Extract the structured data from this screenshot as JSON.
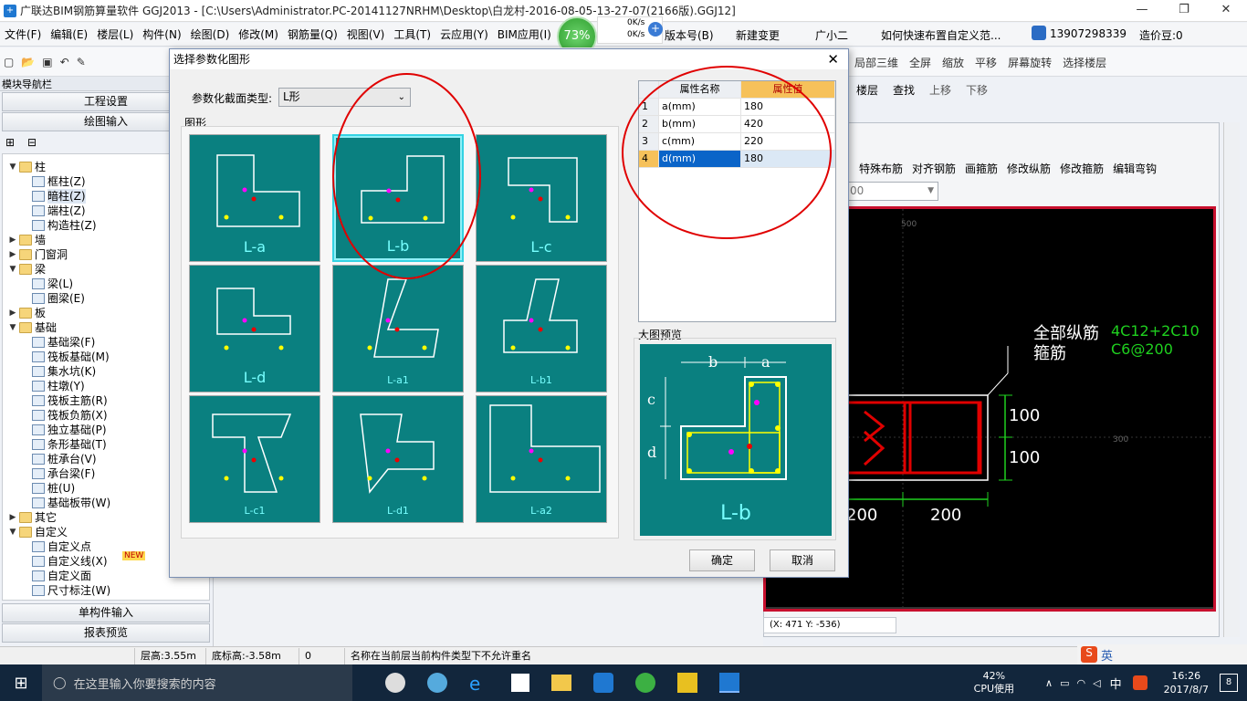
{
  "titlebar": {
    "text": "广联达BIM钢筋算量软件 GGJ2013 - [C:\\Users\\Administrator.PC-20141127NRHM\\Desktop\\白龙村-2016-08-05-13-27-07(2166版).GGJ12]"
  },
  "menu": [
    "文件(F)",
    "编辑(E)",
    "楼层(L)",
    "构件(N)",
    "绘图(D)",
    "修改(M)",
    "钢筋量(Q)",
    "视图(V)",
    "工具(T)",
    "云应用(Y)",
    "BIM应用(I)",
    "在",
    "版本号(B)",
    "新建变更",
    "广小二",
    "如何快速布置自定义范...",
    "13907298339",
    "造价豆:0"
  ],
  "netwidget": {
    "percent": "73%",
    "up": "0K/s",
    "down": "0K/s"
  },
  "toolbar_right": [
    "局部三维",
    "全屏",
    "缩放",
    "平移",
    "屏幕旋转",
    "选择楼层"
  ],
  "nav": {
    "title": "模块导航栏",
    "buttons": [
      "工程设置",
      "绘图输入"
    ],
    "bottom_buttons": [
      "单构件输入",
      "报表预览"
    ],
    "tree": [
      {
        "level": 0,
        "exp": "▼",
        "icon": "folder",
        "label": "柱"
      },
      {
        "level": 1,
        "icon": "comp",
        "label": "框柱(Z)"
      },
      {
        "level": 1,
        "icon": "comp",
        "label": "暗柱(Z)"
      },
      {
        "level": 1,
        "icon": "comp",
        "label": "端柱(Z)"
      },
      {
        "level": 1,
        "icon": "comp",
        "label": "构造柱(Z)"
      },
      {
        "level": 0,
        "exp": "▶",
        "icon": "folder",
        "label": "墙"
      },
      {
        "level": 0,
        "exp": "▶",
        "icon": "folder",
        "label": "门窗洞"
      },
      {
        "level": 0,
        "exp": "▼",
        "icon": "folder",
        "label": "梁"
      },
      {
        "level": 1,
        "icon": "comp",
        "label": "梁(L)"
      },
      {
        "level": 1,
        "icon": "comp",
        "label": "圈梁(E)"
      },
      {
        "level": 0,
        "exp": "▶",
        "icon": "folder",
        "label": "板"
      },
      {
        "level": 0,
        "exp": "▼",
        "icon": "folder",
        "label": "基础"
      },
      {
        "level": 1,
        "icon": "comp",
        "label": "基础梁(F)"
      },
      {
        "level": 1,
        "icon": "comp",
        "label": "筏板基础(M)"
      },
      {
        "level": 1,
        "icon": "comp",
        "label": "集水坑(K)"
      },
      {
        "level": 1,
        "icon": "comp",
        "label": "柱墩(Y)"
      },
      {
        "level": 1,
        "icon": "comp",
        "label": "筏板主筋(R)"
      },
      {
        "level": 1,
        "icon": "comp",
        "label": "筏板负筋(X)"
      },
      {
        "level": 1,
        "icon": "comp",
        "label": "独立基础(P)"
      },
      {
        "level": 1,
        "icon": "comp",
        "label": "条形基础(T)"
      },
      {
        "level": 1,
        "icon": "comp",
        "label": "桩承台(V)"
      },
      {
        "level": 1,
        "icon": "comp",
        "label": "承台梁(F)"
      },
      {
        "level": 1,
        "icon": "comp",
        "label": "桩(U)"
      },
      {
        "level": 1,
        "icon": "comp",
        "label": "基础板带(W)"
      },
      {
        "level": 0,
        "exp": "▶",
        "icon": "folder",
        "label": "其它"
      },
      {
        "level": 0,
        "exp": "▼",
        "icon": "folder",
        "label": "自定义"
      },
      {
        "level": 1,
        "icon": "comp",
        "label": "自定义点"
      },
      {
        "level": 1,
        "icon": "comp",
        "label": "自定义线(X)"
      },
      {
        "level": 1,
        "icon": "comp",
        "label": "自定义面"
      },
      {
        "level": 1,
        "icon": "comp",
        "label": "尺寸标注(W)"
      }
    ],
    "new_badge": "NEW"
  },
  "mid_toolbar": [
    "楼层",
    "查找",
    "上移",
    "下移"
  ],
  "rebar_toolbar": [
    "特殊布筋",
    "对齐钢筋",
    "画箍筋",
    "修改纵筋",
    "修改箍筋",
    "编辑弯钩"
  ],
  "combo_value": "00",
  "canvas": {
    "label1": "全部纵筋",
    "label2": "箍筋",
    "value1": "4C12+2C10",
    "value2": "C6@200",
    "dims": [
      "100",
      "100",
      "200",
      "200"
    ],
    "grid_labels": [
      "500",
      "300"
    ],
    "coords": "(X: 471 Y: -536)"
  },
  "dialog": {
    "title": "选择参数化图形",
    "section_type_label": "参数化截面类型:",
    "section_type_value": "L形",
    "shapes_group": "图形",
    "tiles": [
      "L-a",
      "L-b",
      "L-c",
      "L-d",
      "L-a1",
      "L-b1",
      "L-c1",
      "L-d1",
      "L-a2"
    ],
    "selected": "L-b",
    "table": {
      "headers": [
        "属性名称",
        "属性值"
      ],
      "rows": [
        {
          "n": "1",
          "name": "a(mm)",
          "value": "180"
        },
        {
          "n": "2",
          "name": "b(mm)",
          "value": "420"
        },
        {
          "n": "3",
          "name": "c(mm)",
          "value": "220"
        },
        {
          "n": "4",
          "name": "d(mm)",
          "value": "180"
        }
      ]
    },
    "preview_label": "大图预览",
    "preview_name": "L-b",
    "ok": "确定",
    "cancel": "取消"
  },
  "status": [
    "层高:3.55m",
    "底标高:-3.58m",
    "0",
    "名称在当前层当前构件类型下不允许重名"
  ],
  "taskbar": {
    "search": "在这里输入你要搜索的内容",
    "cpu": "42%",
    "cpu_label": "CPU使用",
    "ime": "中",
    "time": "16:26",
    "date": "2017/8/7",
    "notif": "8"
  },
  "ime_bar": "英"
}
